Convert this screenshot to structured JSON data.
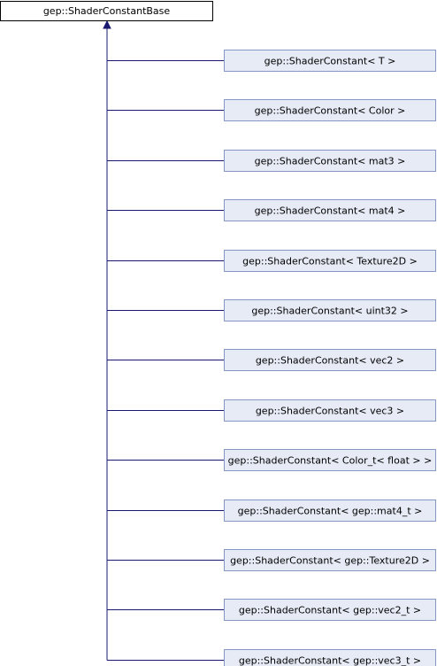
{
  "base_class": {
    "label": "gep::ShaderConstantBase"
  },
  "derived_classes": [
    {
      "label": "gep::ShaderConstant< T >"
    },
    {
      "label": "gep::ShaderConstant< Color >"
    },
    {
      "label": "gep::ShaderConstant< mat3 >"
    },
    {
      "label": "gep::ShaderConstant< mat4 >"
    },
    {
      "label": "gep::ShaderConstant< Texture2D >"
    },
    {
      "label": "gep::ShaderConstant< uint32 >"
    },
    {
      "label": "gep::ShaderConstant< vec2 >"
    },
    {
      "label": "gep::ShaderConstant< vec3 >"
    },
    {
      "label": "gep::ShaderConstant< Color_t< float > >"
    },
    {
      "label": "gep::ShaderConstant< gep::mat4_t >"
    },
    {
      "label": "gep::ShaderConstant< gep::Texture2D >"
    },
    {
      "label": "gep::ShaderConstant< gep::vec2_t >"
    },
    {
      "label": "gep::ShaderConstant< gep::vec3_t >"
    }
  ],
  "colors": {
    "edge": "#191970",
    "child_fill": "#e6ebf5",
    "child_border": "#8497c5",
    "base_fill": "#ffffff",
    "base_border": "#000000"
  }
}
